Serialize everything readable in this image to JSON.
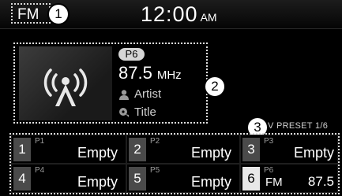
{
  "header": {
    "source": "FM",
    "time": "12:00",
    "ampm": "AM"
  },
  "callouts": [
    "1",
    "2",
    "3"
  ],
  "now_playing": {
    "preset": "P6",
    "frequency": "87.5",
    "unit": "MHz",
    "artist": "Artist",
    "title": "Title"
  },
  "preset_page": "V PRESET 1/6",
  "presets": [
    {
      "num": "1",
      "label": "P1",
      "name": "Empty"
    },
    {
      "num": "2",
      "label": "P2",
      "name": "Empty"
    },
    {
      "num": "3",
      "label": "P3",
      "name": "Empty"
    },
    {
      "num": "4",
      "label": "P4",
      "name": "Empty"
    },
    {
      "num": "5",
      "label": "P5",
      "name": "Empty"
    },
    {
      "num": "6",
      "label": "P6",
      "band": "FM",
      "freq": "87.5"
    }
  ],
  "icons": [
    "radio-antenna-icon",
    "artist-icon",
    "title-icon"
  ]
}
